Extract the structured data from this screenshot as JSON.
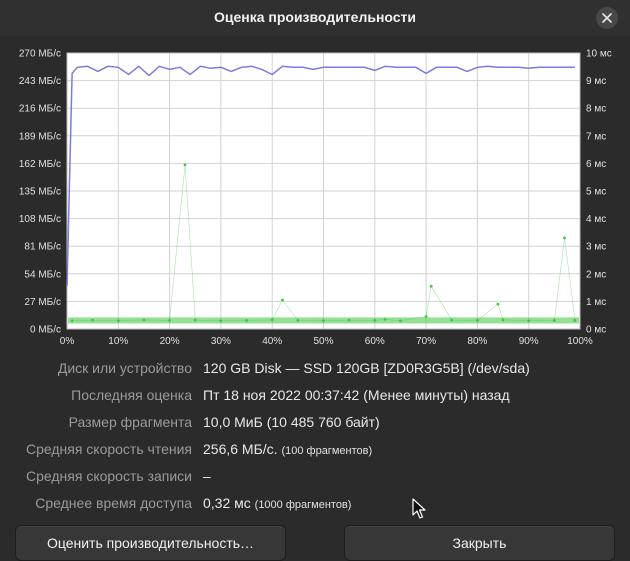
{
  "window": {
    "title": "Оценка производительности"
  },
  "chart_data": {
    "type": "line",
    "left_axis": {
      "labels": [
        "270 МБ/с",
        "243 МБ/с",
        "216 МБ/с",
        "189 МБ/с",
        "162 МБ/с",
        "135 МБ/с",
        "108 МБ/с",
        "81 МБ/с",
        "54 МБ/с",
        "27 МБ/с",
        "0 МБ/с"
      ],
      "range": [
        0,
        270
      ]
    },
    "right_axis": {
      "labels": [
        "10 мс",
        "9 мс",
        "8 мс",
        "7 мс",
        "6 мс",
        "5 мс",
        "4 мс",
        "3 мс",
        "2 мс",
        "1 мс",
        "0 мс"
      ],
      "range": [
        0,
        10
      ]
    },
    "x_axis": {
      "labels": [
        "0%",
        "10%",
        "20%",
        "30%",
        "40%",
        "50%",
        "60%",
        "70%",
        "80%",
        "90%",
        "100%"
      ],
      "range": [
        0,
        100
      ]
    },
    "grid": true,
    "series": [
      {
        "color": "#7b7bdc",
        "axis": "left",
        "x": [
          0,
          1,
          2,
          4,
          6,
          8,
          10,
          12,
          14,
          16,
          18,
          20,
          22,
          24,
          26,
          28,
          30,
          32,
          34,
          36,
          38,
          40,
          42,
          44,
          46,
          48,
          50,
          52,
          54,
          56,
          58,
          60,
          62,
          64,
          66,
          68,
          70,
          72,
          74,
          76,
          78,
          80,
          82,
          84,
          86,
          88,
          90,
          92,
          94,
          96,
          98,
          99
        ],
        "y": [
          42,
          250,
          256,
          257,
          252,
          257,
          256,
          249,
          257,
          248,
          257,
          254,
          256,
          249,
          257,
          255,
          256,
          252,
          256,
          257,
          254,
          249,
          257,
          256,
          256,
          254,
          256,
          256,
          256,
          256,
          256,
          253,
          257,
          256,
          256,
          256,
          250,
          256,
          256,
          256,
          252,
          256,
          257,
          256,
          256,
          256,
          255,
          256,
          256,
          256,
          256,
          256
        ]
      },
      {
        "color": "#3fc73f",
        "axis": "right",
        "x": [
          1,
          5,
          10,
          15,
          20,
          23,
          25,
          30,
          35,
          40,
          42,
          45,
          50,
          55,
          60,
          62,
          65,
          70,
          71,
          75,
          80,
          84,
          85,
          90,
          95,
          97,
          99
        ],
        "y": [
          0.3,
          0.32,
          0.3,
          0.33,
          0.31,
          5.95,
          0.32,
          0.3,
          0.31,
          0.33,
          1.05,
          0.31,
          0.3,
          0.32,
          0.31,
          0.35,
          0.3,
          0.45,
          1.55,
          0.32,
          0.31,
          0.9,
          0.33,
          0.3,
          0.31,
          3.3,
          0.31
        ]
      }
    ]
  },
  "info": [
    {
      "label": "Диск или устройство",
      "value": "120 GB Disk — SSD 120GB [ZD0R3G5B] (/dev/sda)",
      "note": ""
    },
    {
      "label": "Последняя оценка",
      "value": "Пт 18 ноя 2022 00:37:42 (Менее минуты) назад",
      "note": ""
    },
    {
      "label": "Размер фрагмента",
      "value": "10,0 МиБ (10 485 760 байт)",
      "note": ""
    },
    {
      "label": "Средняя скорость чтения",
      "value": "256,6 МБ/с.",
      "note": "(100 фрагментов)"
    },
    {
      "label": "Средняя скорость записи",
      "value": "–",
      "note": ""
    },
    {
      "label": "Среднее время доступа",
      "value": "0,32 мс",
      "note": "(1000 фрагментов)"
    }
  ],
  "buttons": {
    "benchmark": "Оценить производительность…",
    "close": "Закрыть"
  },
  "icons": {
    "close": "close-icon",
    "cursor": "mouse-pointer-icon"
  }
}
